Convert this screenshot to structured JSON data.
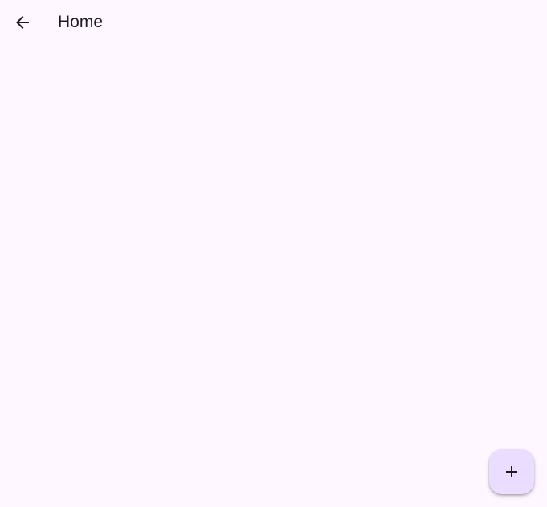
{
  "app_bar": {
    "title": "Home",
    "back_icon": "arrow-back-icon"
  },
  "fab": {
    "icon": "add-icon"
  },
  "colors": {
    "background": "#fef7ff",
    "fab_background": "#eaddff",
    "icon": "#1d1b20",
    "text": "#1d1b20"
  }
}
